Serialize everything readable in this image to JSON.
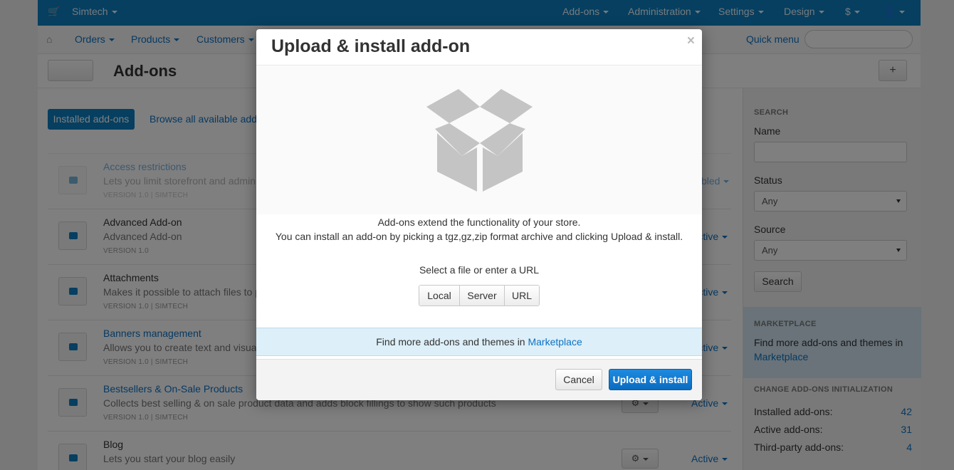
{
  "topbar": {
    "store": "Simtech",
    "menus": [
      "Add-ons",
      "Administration",
      "Settings",
      "Design",
      "$"
    ]
  },
  "navbar": {
    "items": [
      "Orders",
      "Products",
      "Customers"
    ],
    "quick_menu": "Quick menu"
  },
  "page": {
    "title": "Add-ons",
    "tabs": {
      "installed": "Installed add-ons",
      "browse": "Browse all available add-o"
    }
  },
  "addons": [
    {
      "name": "Access restrictions",
      "desc": "Lets you limit storefront and administ",
      "version": "VERSION 1.0  |  SIMTECH",
      "status": "bled"
    },
    {
      "name": "Advanced Add-on",
      "desc": "Advanced Add-on",
      "version": "VERSION 1.0",
      "status": "Active"
    },
    {
      "name": "Attachments",
      "desc": "Makes it possible to attach files to p",
      "version": "VERSION 1.0  |  SIMTECH",
      "status": "Active"
    },
    {
      "name": "Banners management",
      "desc": "Allows you to create text and visual b",
      "version": "VERSION 1.0  |  SIMTECH",
      "status": "Active"
    },
    {
      "name": "Bestsellers & On-Sale Products",
      "desc": "Collects best selling & on sale product data and adds block fillings to show such products",
      "version": "VERSION 1.0  |  SIMTECH",
      "status": "Active"
    },
    {
      "name": "Blog",
      "desc": "Lets you start your blog easily",
      "version": "",
      "status": "Active"
    }
  ],
  "sidebar": {
    "search_heading": "SEARCH",
    "name_label": "Name",
    "status_label": "Status",
    "status_value": "Any",
    "source_label": "Source",
    "source_value": "Any",
    "search_button": "Search",
    "marketplace_heading": "MARKETPLACE",
    "marketplace_text": "Find more add-ons and themes in",
    "marketplace_link": "Marketplace",
    "stats_heading": "CHANGE ADD-ONS INITIALIZATION",
    "stats": [
      {
        "label": "Installed add-ons:",
        "value": "42"
      },
      {
        "label": "Active add-ons:",
        "value": "31"
      },
      {
        "label": "Third-party add-ons:",
        "value": "4"
      }
    ]
  },
  "modal": {
    "title": "Upload & install add-on",
    "close": "×",
    "intro_line1": "Add-ons extend the functionality of your store.",
    "intro_line2": "You can install an add-on by picking a tgz,gz,zip format archive and clicking Upload & install.",
    "select_label": "Select a file or enter a URL",
    "source_options": [
      "Local",
      "Server",
      "URL"
    ],
    "marketplace_text": "Find more add-ons and themes in",
    "marketplace_link": "Marketplace",
    "cancel": "Cancel",
    "submit": "Upload & install"
  }
}
